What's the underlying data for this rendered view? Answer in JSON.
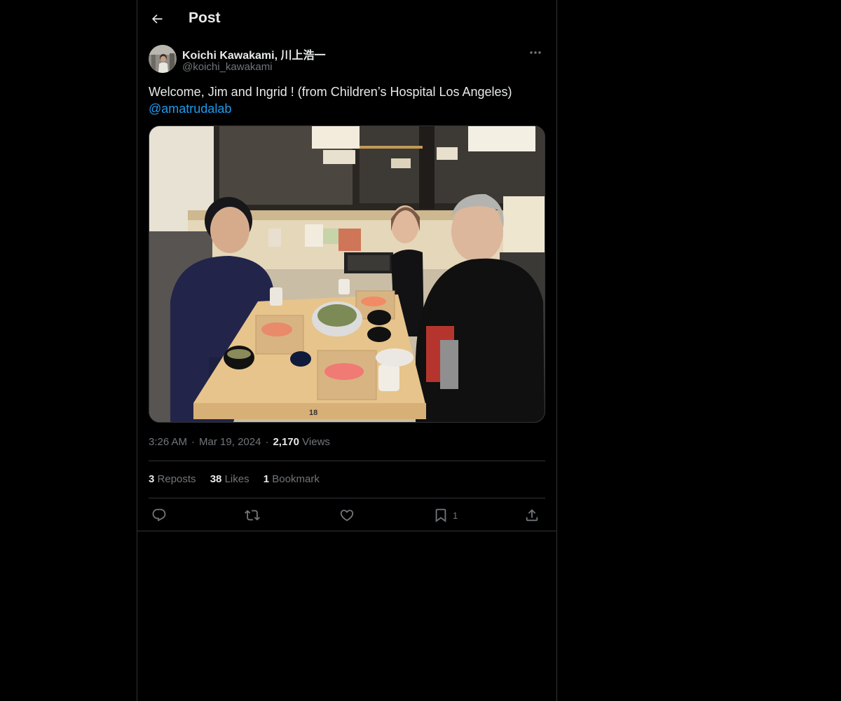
{
  "header": {
    "title": "Post",
    "back_icon": "arrow-left-icon"
  },
  "post": {
    "author": {
      "name": "Koichi Kawakami, 川上浩一",
      "handle": "@koichi_kawakami"
    },
    "text": "Welcome, Jim and Ingrid ! (from Children’s Hospital Los Angeles)",
    "mention": "@amatrudalab",
    "photo_table_number": "18",
    "meta": {
      "time": "3:26 AM",
      "date": "Mar 19, 2024",
      "views_count": "2,170",
      "views_label": "Views"
    },
    "stats": {
      "reposts_count": "3",
      "reposts_label": "Reposts",
      "likes_count": "38",
      "likes_label": "Likes",
      "bookmarks_count": "1",
      "bookmarks_label": "Bookmark"
    },
    "actions": {
      "reply_icon": "reply-icon",
      "repost_icon": "repost-icon",
      "like_icon": "heart-icon",
      "bookmark_icon": "bookmark-icon",
      "bookmark_count": "1",
      "share_icon": "share-icon"
    }
  },
  "colors": {
    "background": "#000000",
    "text": "#e7e9ea",
    "muted": "#71767b",
    "link": "#1d9bf0",
    "border": "#2f3336"
  }
}
